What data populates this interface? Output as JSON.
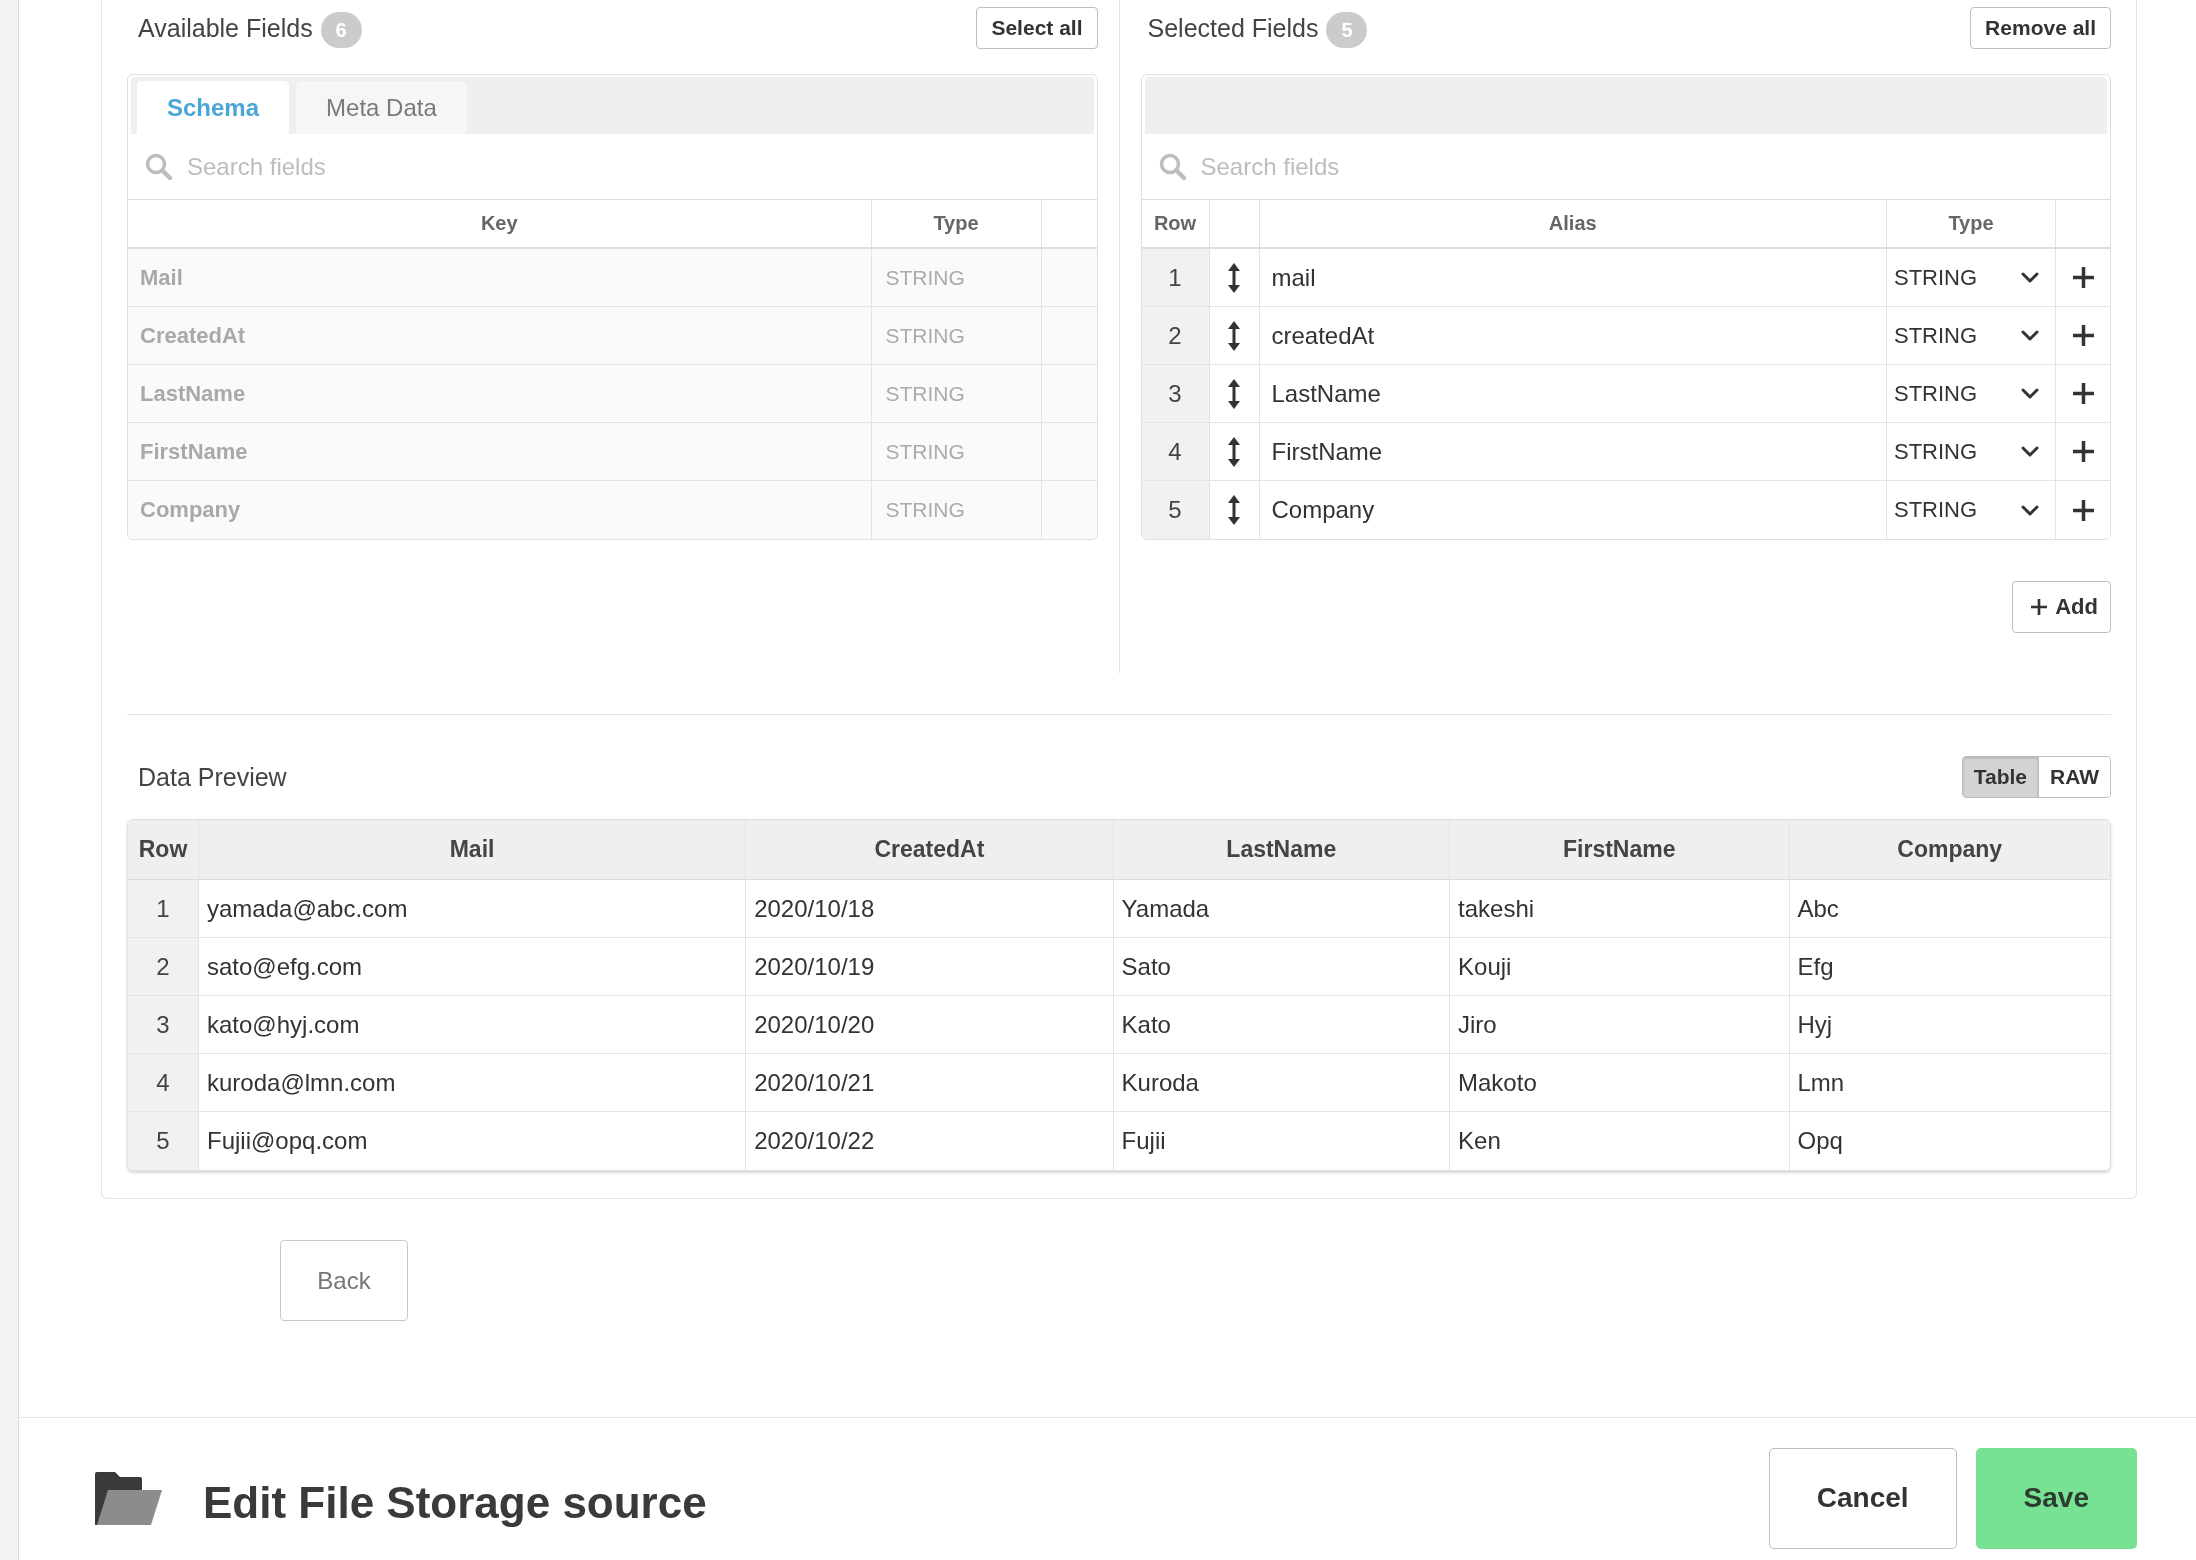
{
  "available_fields": {
    "title": "Available Fields",
    "count": "6",
    "select_all": "Select all",
    "tabs": [
      {
        "label": "Schema",
        "selected": true
      },
      {
        "label": "Meta Data",
        "selected": false
      }
    ],
    "search": {
      "placeholder": "Search fields"
    },
    "columns": [
      "Key",
      "Type"
    ],
    "rows": [
      {
        "key": "Mail",
        "type": "STRING",
        "disabled": true
      },
      {
        "key": "CreatedAt",
        "type": "STRING",
        "disabled": true
      },
      {
        "key": "LastName",
        "type": "STRING",
        "disabled": true
      },
      {
        "key": "FirstName",
        "type": "STRING",
        "disabled": true
      },
      {
        "key": "Company",
        "type": "STRING",
        "disabled": true
      }
    ]
  },
  "selected_fields": {
    "title": "Selected Fields",
    "count": "5",
    "remove_all": "Remove all",
    "search": {
      "placeholder": "Search fields"
    },
    "columns": [
      "Row",
      "Alias",
      "Type"
    ],
    "rows": [
      {
        "row": "1",
        "alias": "mail",
        "type": "STRING"
      },
      {
        "row": "2",
        "alias": "createdAt",
        "type": "STRING"
      },
      {
        "row": "3",
        "alias": "LastName",
        "type": "STRING"
      },
      {
        "row": "4",
        "alias": "FirstName",
        "type": "STRING"
      },
      {
        "row": "5",
        "alias": "Company",
        "type": "STRING"
      }
    ],
    "add": "Add"
  },
  "data_preview": {
    "title": "Data Preview",
    "views": [
      {
        "label": "Table",
        "selected": true
      },
      {
        "label": "RAW",
        "selected": false
      }
    ],
    "columns": [
      "Row",
      "Mail",
      "CreatedAt",
      "LastName",
      "FirstName",
      "Company"
    ],
    "rows": [
      [
        "1",
        "yamada@abc.com",
        "2020/10/18",
        "Yamada",
        "takeshi",
        "Abc"
      ],
      [
        "2",
        "sato@efg.com",
        "2020/10/19",
        "Sato",
        "Kouji",
        "Efg"
      ],
      [
        "3",
        "kato@hyj.com",
        "2020/10/20",
        "Kato",
        "Jiro",
        "Hyj"
      ],
      [
        "4",
        "kuroda@lmn.com",
        "2020/10/21",
        "Kuroda",
        "Makoto",
        "Lmn"
      ],
      [
        "5",
        "Fujii@opq.com",
        "2020/10/22",
        "Fujii",
        "Ken",
        "Opq"
      ]
    ]
  },
  "back": "Back",
  "footer": {
    "title": "Edit File Storage source",
    "buttons": [
      {
        "label": "Cancel",
        "kind": "secondary"
      },
      {
        "label": "Save",
        "kind": "primary"
      }
    ]
  }
}
